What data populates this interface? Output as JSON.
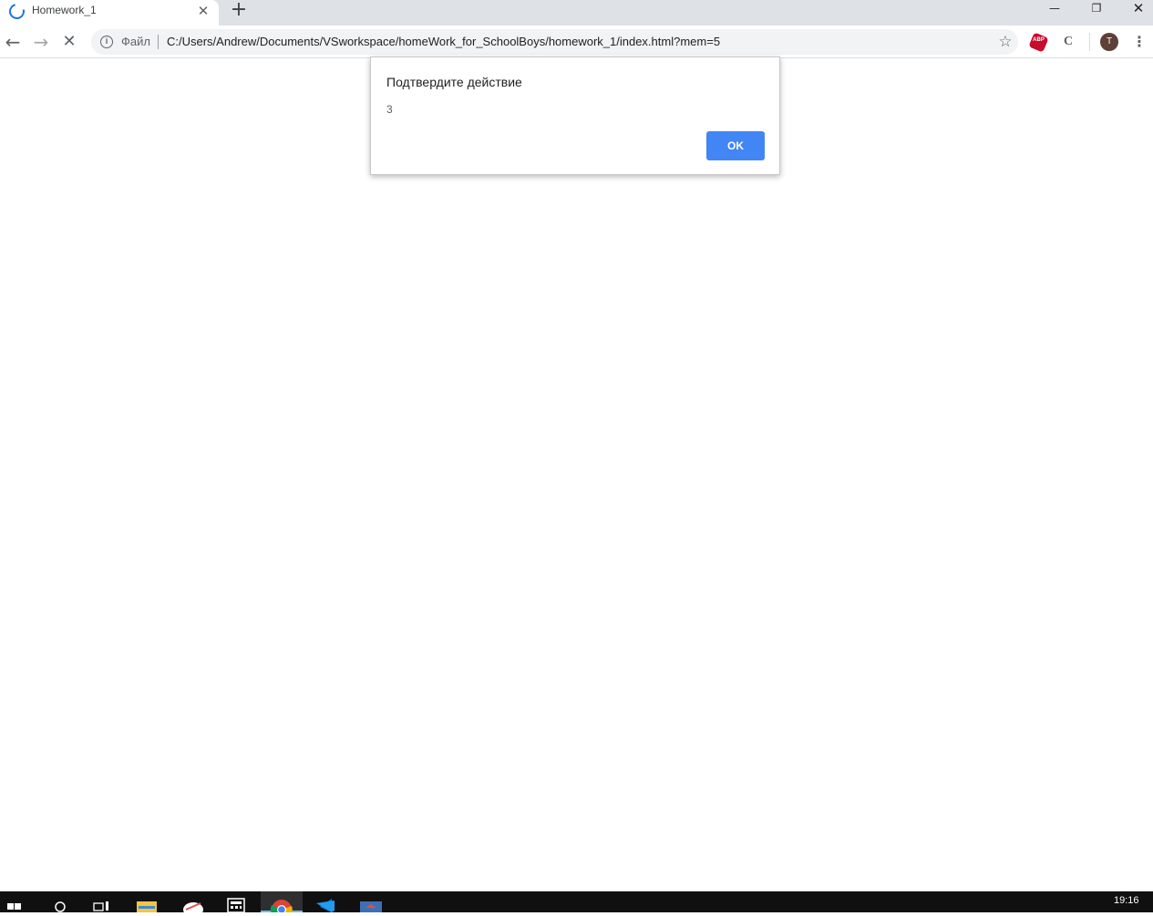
{
  "browser": {
    "tab": {
      "title": "Homework_1",
      "close_glyph": "✕"
    },
    "new_tab_glyph": "+",
    "window_controls": {
      "minimize": "—",
      "maximize": "❐",
      "close": "✕"
    },
    "nav": {
      "back": "←",
      "forward": "→",
      "stop": "✕"
    },
    "omnibox": {
      "scheme_label": "Файл",
      "url": "C:/Users/Andrew/Documents/VSworkspace/homeWork_for_SchoolBoys/homework_1/index.html?mem=5",
      "bookmark_glyph": "☆"
    },
    "extensions": {
      "abp_label": "ABP",
      "c_label": "C"
    },
    "profile_initial": "T",
    "menu_glyph": "⋮"
  },
  "dialog": {
    "title": "Подтвердите действие",
    "message": "3",
    "ok_label": "OK"
  },
  "taskbar": {
    "clock": "19:16",
    "items": [
      "start-icon",
      "search-icon",
      "task-view-icon",
      "file-explorer-icon",
      "app-icon",
      "calculator-icon",
      "chrome-icon",
      "vscode-icon",
      "app2-icon"
    ]
  },
  "colors": {
    "accent": "#4285f4",
    "tabstrip": "#dee1e6",
    "taskbar": "#101010"
  }
}
